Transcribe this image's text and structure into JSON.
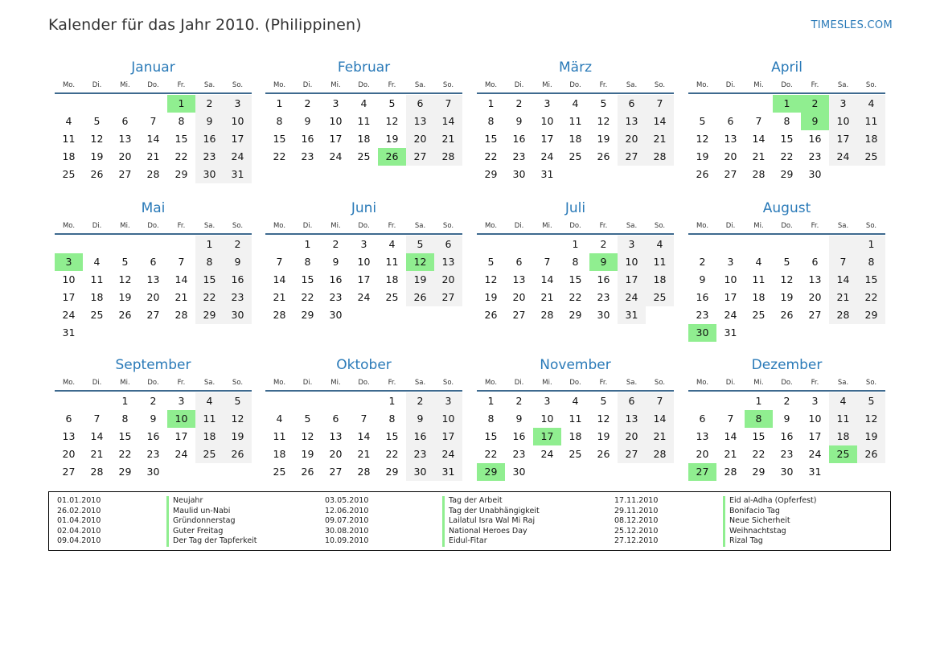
{
  "title": "Kalender für das Jahr 2010. (Philippinen)",
  "brand": "TIMESLES.COM",
  "weekday_labels": [
    "Mo.",
    "Di.",
    "Mi.",
    "Do.",
    "Fr.",
    "Sa.",
    "So."
  ],
  "colors": {
    "accent": "#2a7ab8",
    "holiday": "#90ee90",
    "weekend": "#f2f2f2",
    "rule": "#3e6a8f"
  },
  "months": [
    {
      "name": "Januar",
      "offset": 4,
      "days": 31,
      "holidays": [
        1
      ]
    },
    {
      "name": "Februar",
      "offset": 0,
      "days": 28,
      "holidays": [
        26
      ]
    },
    {
      "name": "März",
      "offset": 0,
      "days": 31,
      "holidays": []
    },
    {
      "name": "April",
      "offset": 3,
      "days": 30,
      "holidays": [
        1,
        2,
        9
      ]
    },
    {
      "name": "Mai",
      "offset": 5,
      "days": 31,
      "holidays": [
        3
      ]
    },
    {
      "name": "Juni",
      "offset": 1,
      "days": 30,
      "holidays": [
        12
      ]
    },
    {
      "name": "Juli",
      "offset": 3,
      "days": 31,
      "holidays": [
        9
      ]
    },
    {
      "name": "August",
      "offset": 6,
      "days": 31,
      "holidays": [
        30
      ]
    },
    {
      "name": "September",
      "offset": 2,
      "days": 30,
      "holidays": [
        10
      ]
    },
    {
      "name": "Oktober",
      "offset": 4,
      "days": 31,
      "holidays": []
    },
    {
      "name": "November",
      "offset": 0,
      "days": 30,
      "holidays": [
        17,
        29
      ]
    },
    {
      "name": "Dezember",
      "offset": 2,
      "days": 31,
      "holidays": [
        8,
        25,
        27
      ]
    }
  ],
  "holiday_list": [
    {
      "date": "01.01.2010",
      "name": "Neujahr"
    },
    {
      "date": "26.02.2010",
      "name": "Maulid un-Nabi"
    },
    {
      "date": "01.04.2010",
      "name": "Gründonnerstag"
    },
    {
      "date": "02.04.2010",
      "name": "Guter Freitag"
    },
    {
      "date": "09.04.2010",
      "name": "Der Tag der Tapferkeit"
    },
    {
      "date": "03.05.2010",
      "name": "Tag der Arbeit"
    },
    {
      "date": "12.06.2010",
      "name": "Tag der Unabhängigkeit"
    },
    {
      "date": "09.07.2010",
      "name": "Lailatul Isra Wal Mi Raj"
    },
    {
      "date": "30.08.2010",
      "name": "National Heroes Day"
    },
    {
      "date": "10.09.2010",
      "name": "Eidul-Fitar"
    },
    {
      "date": "17.11.2010",
      "name": "Eid al-Adha (Opferfest)"
    },
    {
      "date": "29.11.2010",
      "name": "Bonifacio Tag"
    },
    {
      "date": "08.12.2010",
      "name": "Neue Sicherheit"
    },
    {
      "date": "25.12.2010",
      "name": "Weihnachtstag"
    },
    {
      "date": "27.12.2010",
      "name": "Rizal Tag"
    }
  ]
}
